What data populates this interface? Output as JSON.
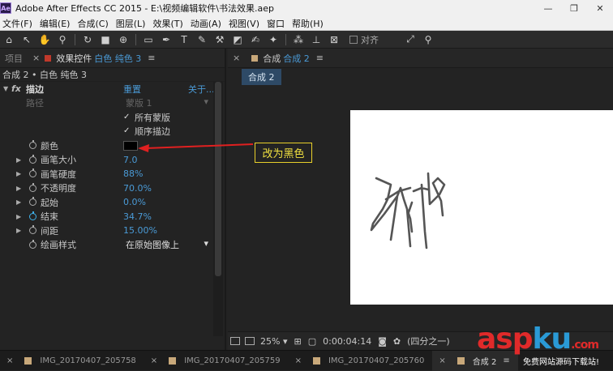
{
  "titlebar": {
    "logo": "Ae",
    "title": "Adobe After Effects CC 2015 - E:\\视频编辑软件\\书法效果.aep",
    "minimize": "—",
    "maximize": "❐",
    "close": "✕"
  },
  "menu": [
    "文件(F)",
    "编辑(E)",
    "合成(C)",
    "图层(L)",
    "效果(T)",
    "动画(A)",
    "视图(V)",
    "窗口",
    "帮助(H)"
  ],
  "toolbar": {
    "align_label": "对齐"
  },
  "left_panel": {
    "tab_project": "项目",
    "tab_effects_prefix": "效果控件",
    "tab_effects_layer": "白色 纯色 3",
    "tab_menu": "≡",
    "breadcrumb": "合成 2 • 白色 纯色 3",
    "effect": {
      "fx": "fx",
      "name": "描边",
      "reset": "重置",
      "about": "关于...",
      "path_label": "路径",
      "path_value": "蒙版 1",
      "all_masks": "所有蒙版",
      "sequential": "顺序描边",
      "color_label": "颜色",
      "color_value": "#000000",
      "brush_size_label": "画笔大小",
      "brush_size_value": "7.0",
      "brush_hardness_label": "画笔硬度",
      "brush_hardness_value": "88%",
      "opacity_label": "不透明度",
      "opacity_value": "70.0%",
      "start_label": "起始",
      "start_value": "0.0%",
      "end_label": "结束",
      "end_value": "34.7%",
      "spacing_label": "间距",
      "spacing_value": "15.00%",
      "paint_style_label": "绘画样式",
      "paint_style_value": "在原始图像上"
    }
  },
  "right_panel": {
    "tab_prefix": "合成",
    "tab_name": "合成 2",
    "tab_menu": "≡",
    "subtab": "合成 2",
    "zoom": "25%",
    "timecode": "0:00:04:14",
    "resolution": "(四分之一)"
  },
  "annotation": {
    "text": "改为黑色",
    "color": "#e8d02a",
    "arrow_color": "#e02020"
  },
  "bottom_tabs": [
    {
      "label": "IMG_20170407_205758"
    },
    {
      "label": "IMG_20170407_205759"
    },
    {
      "label": "IMG_20170407_205760"
    },
    {
      "label": "合成 2"
    }
  ],
  "watermark": {
    "part1": "asp",
    "part2": "ku",
    "suffix": ".com",
    "subtitle": "免费网站源码下载站!",
    "color1": "#e02a2a",
    "color2": "#2a9ad6"
  },
  "colors": {
    "accent_blue": "#4a9ad6",
    "panel_bg": "#232323"
  }
}
